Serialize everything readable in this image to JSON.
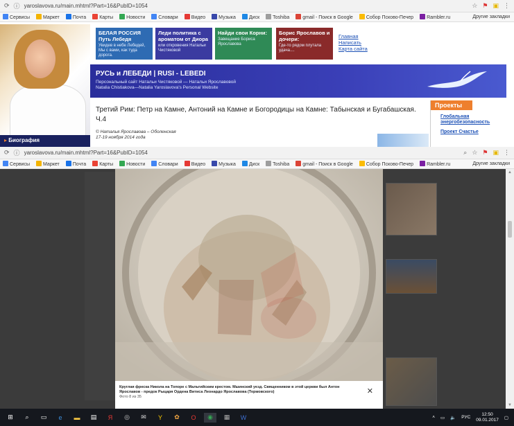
{
  "browser": {
    "url": "yaroslavova.ru/main.mhtml?Part=16&PubID=1054",
    "bookmarks": [
      "Сервисы",
      "Маркет",
      "Почта",
      "Карты",
      "Новости",
      "Словари",
      "Видео",
      "Музыка",
      "Диск",
      "Toshiba",
      "gmail - Поиск в Google",
      "Собор Псково-Печер",
      "Rambler.ru"
    ],
    "bookmarks2": [
      "Сервисы",
      "Маркет",
      "Почта",
      "Карты",
      "Новости",
      "Словари",
      "Видео",
      "Музыка",
      "Диск",
      "Toshiba",
      "gmail - Поиск в Google",
      "Собор Псково-Печер",
      "Rambler.ru"
    ],
    "other_bookmarks": "Другие закладки",
    "bookmark_colors": [
      "#4285f4",
      "#f4b400",
      "#1a73e8",
      "#ea4335",
      "#34a853",
      "#4285f4",
      "#e53935",
      "#3949ab",
      "#1e88e5",
      "#9e9e9e",
      "#db4437",
      "#fbbc05",
      "#7b1fa2"
    ]
  },
  "site": {
    "teasers": [
      {
        "title": "БЕЛАЯ РОССИЯ",
        "subtitle": "Путь Лебедя",
        "text": "Увидев в небе Лебедей, Мы с вами, как туда дорога.",
        "color": "#2e6bb3"
      },
      {
        "title": "Леди политика с ароматом от Диора",
        "subtitle": "",
        "text": "или откровения Натальи Чистяковой",
        "color": "#3b3ba0"
      },
      {
        "title": "Найди свои Корни:",
        "subtitle": "",
        "text": "Завещание Бориса Ярославова",
        "color": "#2f8a56"
      },
      {
        "title": "Борис Ярославов и дочери:",
        "subtitle": "",
        "text": "Где-то рядом плутала удача....",
        "color": "#8a2a2a"
      }
    ],
    "links": [
      "Главная",
      "Написать",
      "Карта сайта"
    ],
    "banner_title": "РУСЬ и ЛЕБЕДИ | RUSI - LEBEDI",
    "banner_sub1": "Персональный сайт Натальи Чистяковой — Натальи Ярославовой",
    "banner_sub2": "Natalia Chistiakova—Natalia Yaroslavova's  Personal Website",
    "bio_label": "Биография",
    "article_title": "Третий Рим: Петр на Камне, Антоний на Камне и Богородицы на Камне: Табынская и Бугабашская. Ч.4",
    "article_author": "© Наталья Ярославова – Оболенская",
    "article_date": "17-19 ноября 2014 года",
    "projects_header": "Проекты",
    "projects": [
      "Глобальная энергобезопасность",
      "Проект Счастье"
    ]
  },
  "lightbox": {
    "caption": "Круглая фреска Никола на Топоре с Мальтийским крестом. Мшинский уезд. Священником в этой церкви был Антон Ярославов - предок Рыцаря Ордена Витиса Леонардо Ярославова (Термовского)",
    "counter": "Фото 8 из 35"
  },
  "taskbar": {
    "language": "РУС",
    "time": "12:50",
    "date": "09.01.2017"
  }
}
